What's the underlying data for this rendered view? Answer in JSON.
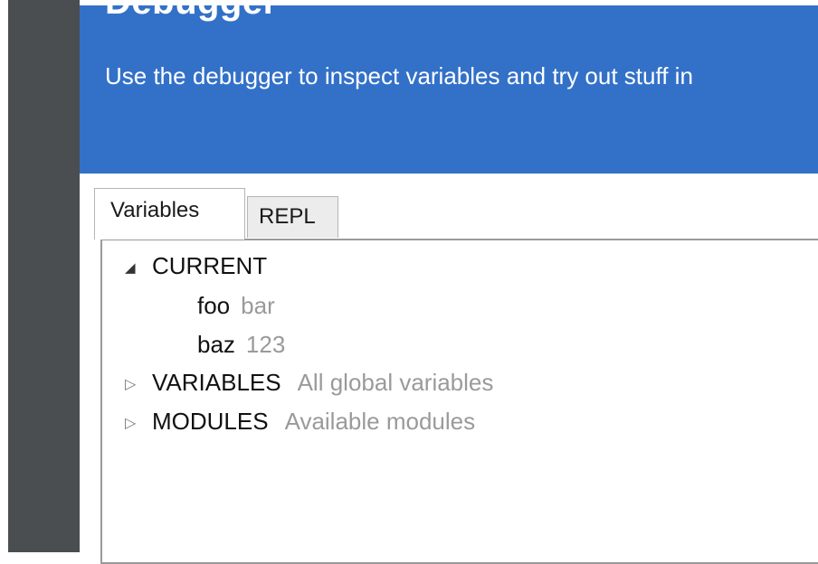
{
  "header": {
    "title": "Debugger",
    "subtitle": "Use the debugger to inspect variables and try out stuff in"
  },
  "tabs": [
    {
      "label": "Variables",
      "active": true
    },
    {
      "label": "REPL",
      "active": false
    }
  ],
  "tree": {
    "current": {
      "label": "CURRENT",
      "expanded": true,
      "items": [
        {
          "key": "foo",
          "value": "bar"
        },
        {
          "key": "baz",
          "value": "123"
        }
      ]
    },
    "variables": {
      "label": "VARIABLES",
      "description": "All global variables",
      "expanded": false
    },
    "modules": {
      "label": "MODULES",
      "description": "Available modules",
      "expanded": false
    }
  },
  "icons": {
    "expanded": "triangle-down-icon",
    "collapsed": "triangle-right-icon"
  },
  "colors": {
    "header_bg": "#3371c8",
    "sidebar_bg": "#4a4e50",
    "muted_text": "#9a9a9a"
  }
}
